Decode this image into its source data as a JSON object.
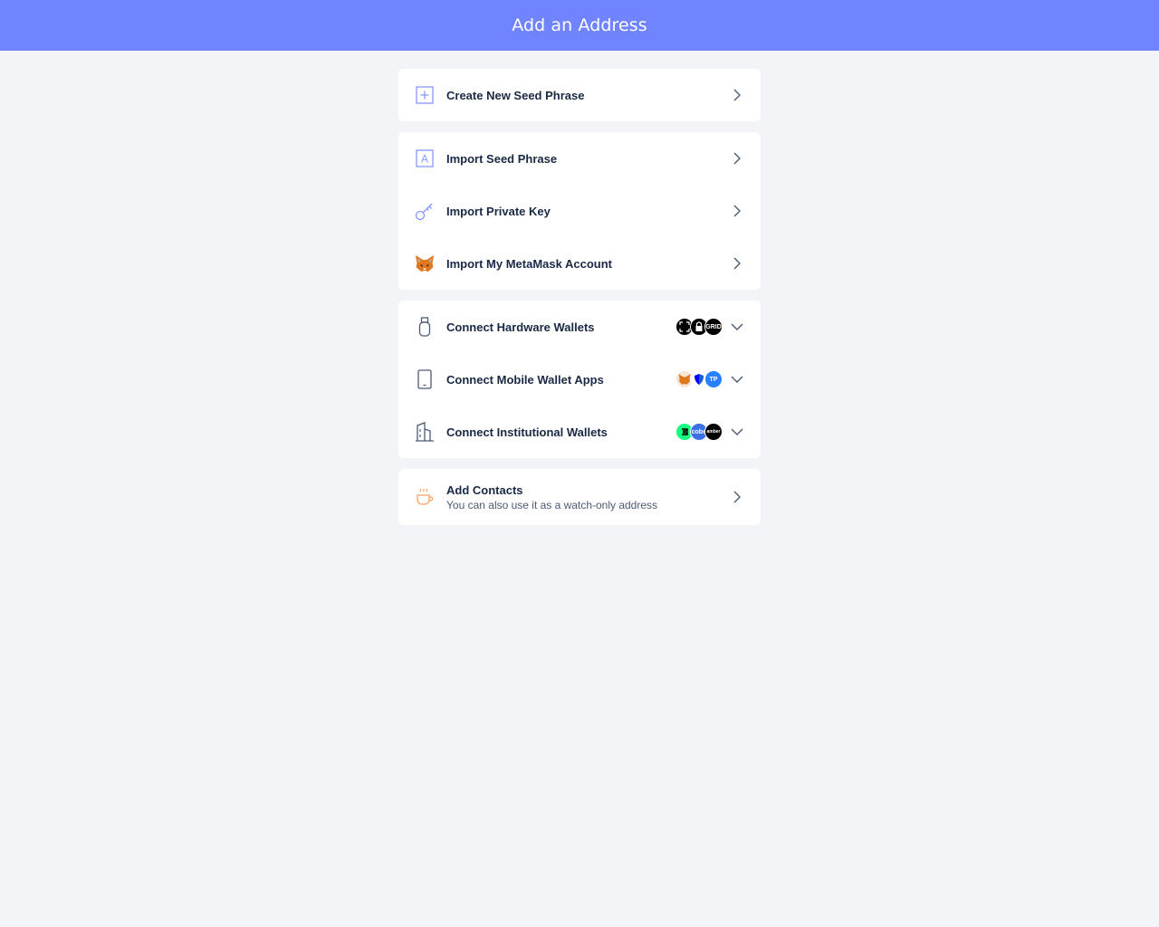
{
  "header": {
    "title": "Add an Address"
  },
  "groups": {
    "create": {
      "new_seed": {
        "label": "Create New Seed Phrase"
      }
    },
    "import": {
      "seed": {
        "label": "Import Seed Phrase"
      },
      "private_key": {
        "label": "Import Private Key"
      },
      "metamask": {
        "label": "Import My MetaMask Account"
      }
    },
    "connect": {
      "hardware": {
        "label": "Connect Hardware Wallets",
        "logos": [
          "ledger-logo",
          "trezor-logo",
          "gridplus-logo"
        ],
        "logo_text": [
          "",
          "",
          "GRID"
        ]
      },
      "mobile": {
        "label": "Connect Mobile Wallet Apps",
        "logos": [
          "metamask-logo",
          "trust-logo",
          "tokenpocket-logo"
        ],
        "logo_text": [
          "",
          "",
          "TP"
        ]
      },
      "institutional": {
        "label": "Connect Institutional Wallets",
        "logos": [
          "gnosis-logo",
          "cobo-logo",
          "amber-logo"
        ],
        "logo_text": [
          "",
          "cobo",
          "amber"
        ]
      }
    },
    "contacts": {
      "label": "Add Contacts",
      "sub": "You can also use it as a watch-only address"
    }
  },
  "colors": {
    "header": "#7084ff",
    "accent": "#7084ff",
    "background": "#f2f4f7",
    "text": "#192945"
  }
}
